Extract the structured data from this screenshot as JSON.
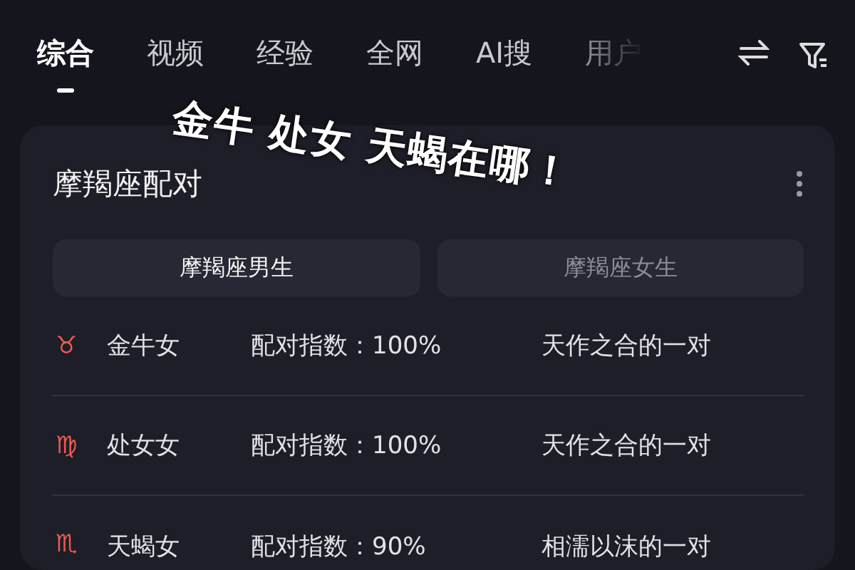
{
  "tabs": [
    {
      "label": "综合",
      "selected": true
    },
    {
      "label": "视频",
      "selected": false
    },
    {
      "label": "经验",
      "selected": false
    },
    {
      "label": "全网",
      "selected": false
    },
    {
      "label": "AI搜",
      "selected": false
    },
    {
      "label": "用户",
      "selected": false
    }
  ],
  "caption": "金牛 处女 天蝎在哪！",
  "card": {
    "title": "摩羯座配对",
    "segments": [
      {
        "label": "摩羯座男生",
        "selected": true
      },
      {
        "label": "摩羯座女生",
        "selected": false
      }
    ],
    "rows": [
      {
        "symbol": "♉",
        "name": "金牛女",
        "score": "配对指数：100%",
        "verdict": "天作之合的一对"
      },
      {
        "symbol": "♍",
        "name": "处女女",
        "score": "配对指数：100%",
        "verdict": "天作之合的一对"
      },
      {
        "symbol": "♏",
        "name": "天蝎女",
        "score": "配对指数：90%",
        "verdict": "相濡以沫的一对"
      }
    ]
  }
}
